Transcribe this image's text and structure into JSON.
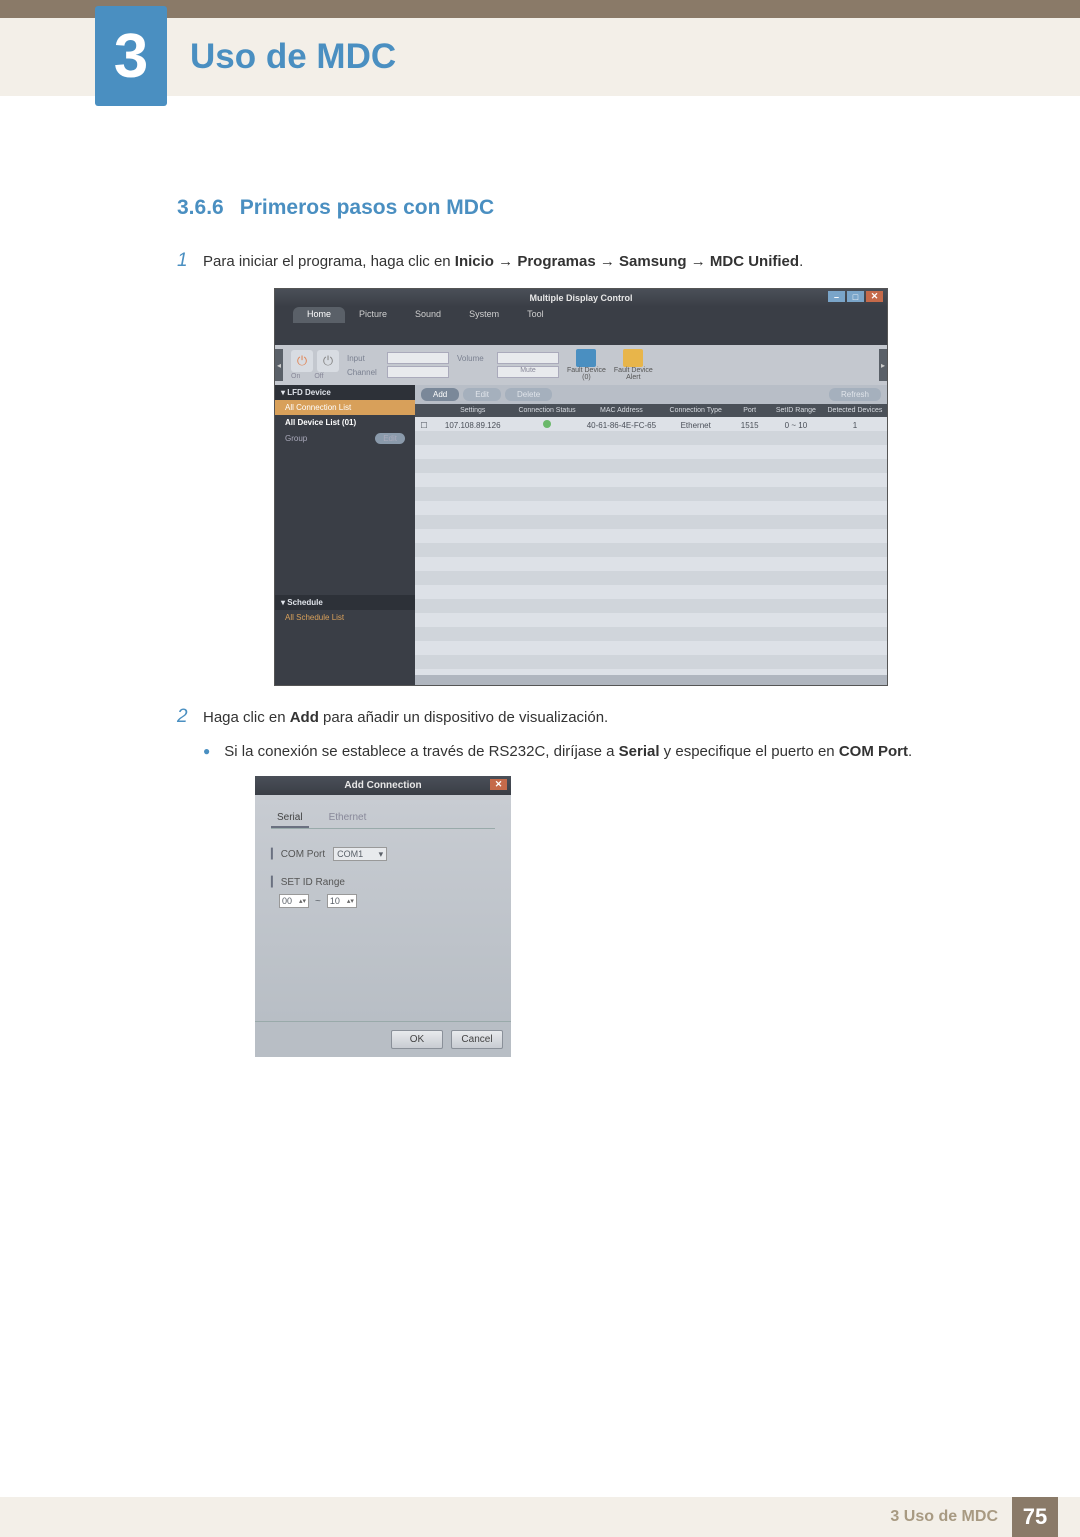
{
  "header": {
    "chapter_num": "3",
    "chapter_title": "Uso de MDC"
  },
  "section": {
    "number": "3.6.6",
    "title": "Primeros pasos con MDC"
  },
  "steps": {
    "s1": {
      "num": "1",
      "text_pre": "Para iniciar el programa, haga clic en ",
      "b1": "Inicio",
      "arrow": " → ",
      "b2": "Programas",
      "b3": "Samsung",
      "b4": "MDC Unified",
      "period": "."
    },
    "s2": {
      "num": "2",
      "text_pre": "Haga clic en ",
      "b1": "Add",
      "text_post": " para añadir un dispositivo de visualización."
    },
    "bullet": {
      "pre": "Si la conexión se establece a través de RS232C, diríjase a ",
      "b1": "Serial",
      "mid": " y especifique el puerto en ",
      "b2": "COM Port",
      "period": "."
    }
  },
  "mdc": {
    "title": "Multiple Display Control",
    "tabs": {
      "home": "Home",
      "picture": "Picture",
      "sound": "Sound",
      "system": "System",
      "tool": "Tool"
    },
    "toolbar": {
      "on": "On",
      "off": "Off",
      "input_l": "Input",
      "channel_l": "Channel",
      "volume_l": "Volume",
      "mute_l": "Mute",
      "fault_dev": "Fault Device",
      "fault_dev_n": "(0)",
      "fault_alert": "Fault Device",
      "fault_alert2": "Alert"
    },
    "side": {
      "lfd": "LFD Device",
      "all_conn": "All Connection List",
      "all_dev": "All Device List (01)",
      "group": "Group",
      "edit": "Edit",
      "schedule": "Schedule",
      "all_sched": "All Schedule List"
    },
    "main": {
      "add": "Add",
      "edit": "Edit",
      "delete": "Delete",
      "refresh": "Refresh",
      "h_set": "Settings",
      "h_con": "Connection Status",
      "h_mac": "MAC Address",
      "h_typ": "Connection Type",
      "h_prt": "Port",
      "h_rng": "SetID Range",
      "h_det": "Detected Devices",
      "row": {
        "set": "107.108.89.126",
        "mac": "40-61-86-4E-FC-65",
        "typ": "Ethernet",
        "prt": "1515",
        "rng": "0 ~ 10",
        "det": "1"
      }
    }
  },
  "dlg": {
    "title": "Add Connection",
    "tab_serial": "Serial",
    "tab_eth": "Ethernet",
    "com_port_l": "COM Port",
    "com_port_v": "COM1",
    "setid_l": "SET ID Range",
    "r_from": "00",
    "r_to": "10",
    "tilde": "~",
    "ok": "OK",
    "cancel": "Cancel"
  },
  "footer": {
    "text": "3 Uso de MDC",
    "page": "75"
  }
}
